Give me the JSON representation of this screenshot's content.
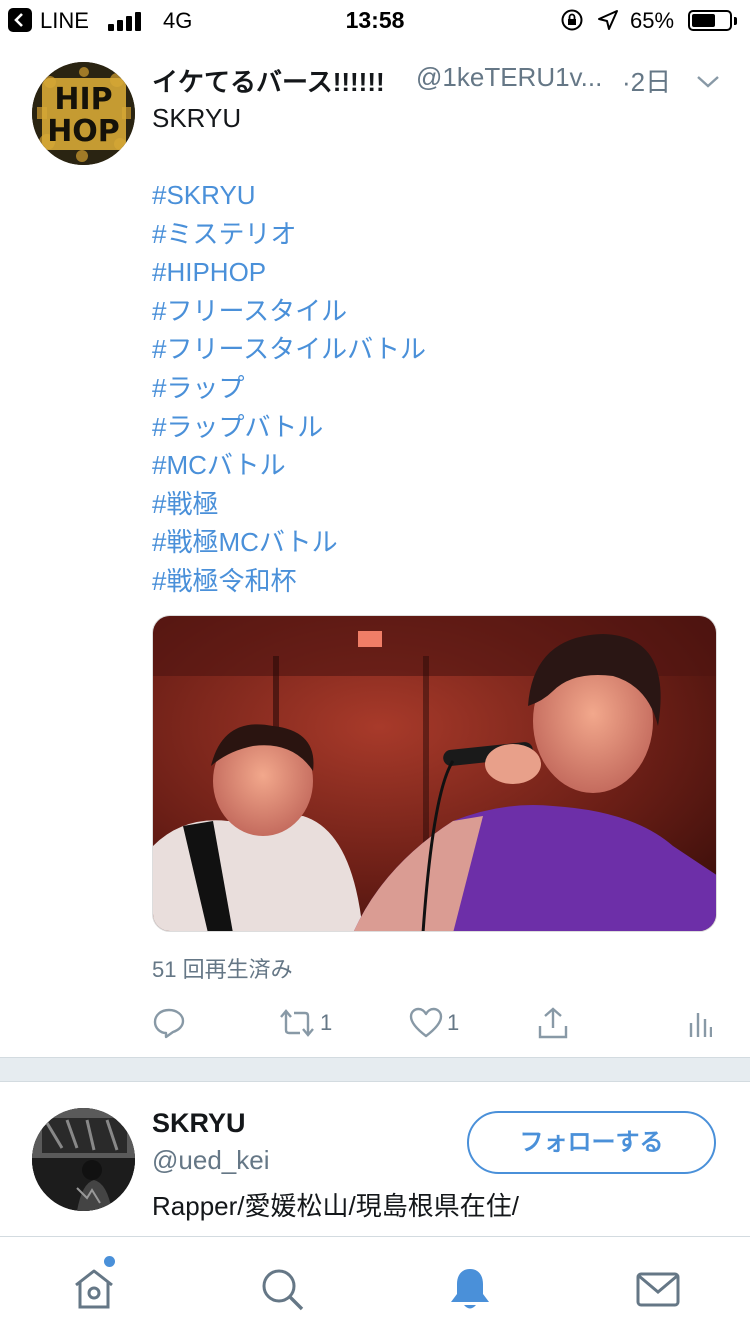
{
  "status_bar": {
    "back_app": "LINE",
    "network": "4G",
    "time": "13:58",
    "battery_percent": "65%",
    "battery_level": 0.65
  },
  "tweet": {
    "author_name": "イケてるバース!!!!!!",
    "author_handle": "@1keTERU1v...",
    "time": "·2日",
    "title": "SKRYU",
    "hashtags": [
      "#SKRYU",
      "#ミステリオ",
      "#HIPHOP",
      "#フリースタイル",
      "#フリースタイルバトル",
      "#ラップ",
      "#ラップバトル",
      "#MCバトル",
      "#戦極",
      "#戦極MCバトル",
      "#戦極令和杯"
    ],
    "view_count": "51 回再生済み",
    "retweet_count": "1",
    "like_count": "1",
    "avatar_icon": "hiphop-logo",
    "avatar_logo_text": "HIP HOP"
  },
  "user_card": {
    "name": "SKRYU",
    "handle": "@ued_kei",
    "bio": "Rapper/愛媛松山/現島根県在住/",
    "follow_label": "フォローする"
  },
  "tab_bar": {
    "tabs": [
      "home-icon",
      "search-icon",
      "notifications-icon",
      "messages-icon"
    ],
    "active": "notifications-icon"
  },
  "colors": {
    "accent": "#4a90d9",
    "secondary_text": "#657786",
    "separator": "#e6ecf0"
  }
}
